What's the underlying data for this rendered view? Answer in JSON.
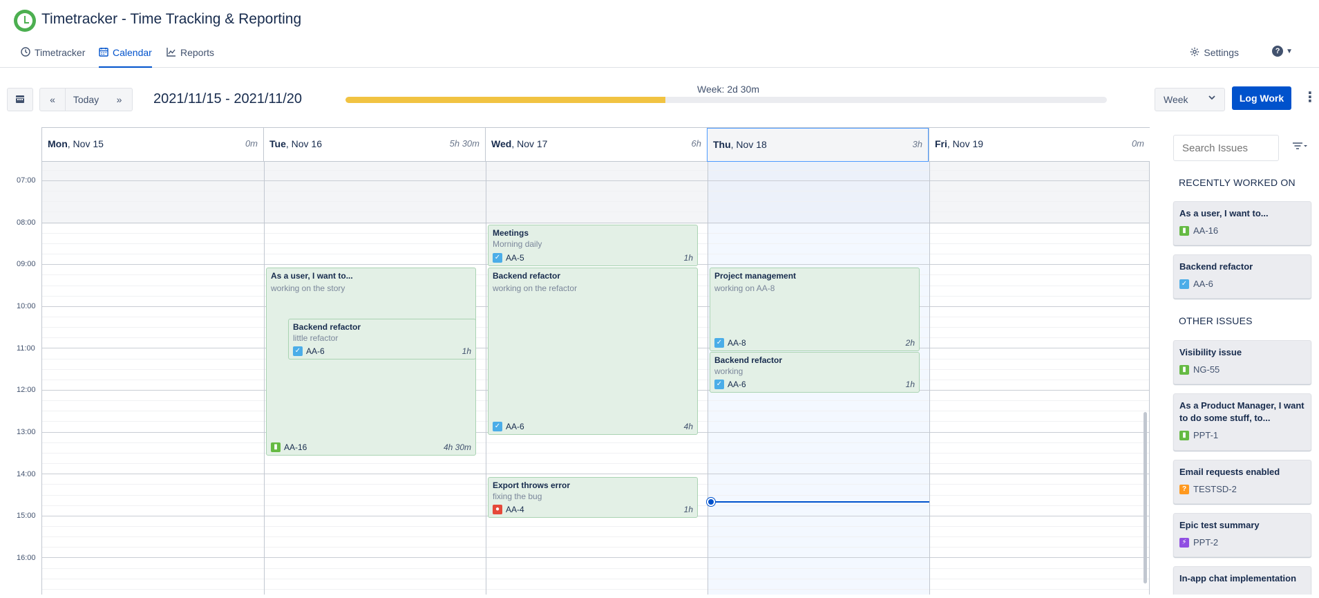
{
  "app": {
    "title": "Timetracker - Time Tracking & Reporting"
  },
  "nav": {
    "tabs": [
      {
        "label": "Timetracker",
        "icon": "clock-icon"
      },
      {
        "label": "Calendar",
        "icon": "calendar-icon",
        "active": true
      },
      {
        "label": "Reports",
        "icon": "chart-icon"
      }
    ],
    "settings_label": "Settings",
    "help_icon": "help-icon"
  },
  "toolbar": {
    "today_label": "Today",
    "prev_icon": "«",
    "next_icon": "»",
    "date_range": "2021/11/15 - 2021/11/20",
    "week_total": "Week: 2d 30m",
    "week_progress": 0.42,
    "view": "Week",
    "log_work_label": "Log Work"
  },
  "calendar": {
    "days": [
      {
        "name": "Mon",
        "date": ", Nov 15",
        "total": "0m"
      },
      {
        "name": "Tue",
        "date": ", Nov 16",
        "total": "5h 30m"
      },
      {
        "name": "Wed",
        "date": ", Nov 17",
        "total": "6h"
      },
      {
        "name": "Thu",
        "date": ", Nov 18",
        "total": "3h",
        "today": true
      },
      {
        "name": "Fri",
        "date": ", Nov 19",
        "total": "0m"
      }
    ],
    "hours": [
      "07:00",
      "08:00",
      "09:00",
      "10:00",
      "11:00",
      "12:00",
      "13:00",
      "14:00",
      "15:00",
      "16:00"
    ],
    "events": [
      {
        "title": "Meetings",
        "description": "Morning daily",
        "key": "AA-5",
        "type": "task",
        "duration": "1h"
      },
      {
        "title": "As a user, I want to...",
        "description": "working on the story",
        "key": "AA-16",
        "type": "story",
        "duration": "4h 30m"
      },
      {
        "title": "Backend refactor",
        "description": "little refactor",
        "key": "AA-6",
        "type": "task",
        "duration": "1h"
      },
      {
        "title": "Backend refactor",
        "description": "working on the refactor",
        "key": "AA-6",
        "type": "task",
        "duration": "4h"
      },
      {
        "title": "Project management",
        "description": "working on AA-8",
        "key": "AA-8",
        "type": "task",
        "duration": "2h"
      },
      {
        "title": "Backend refactor",
        "description": "working",
        "key": "AA-6",
        "type": "task",
        "duration": "1h"
      },
      {
        "title": "Export throws error",
        "description": "fixing the bug",
        "key": "AA-4",
        "type": "bug",
        "duration": "1h"
      }
    ]
  },
  "sidebar": {
    "search_placeholder": "Search Issues",
    "recent_title": "RECENTLY WORKED ON",
    "recent": [
      {
        "title": "As a user, I want to...",
        "key": "AA-16",
        "type": "story"
      },
      {
        "title": "Backend refactor",
        "key": "AA-6",
        "type": "task"
      }
    ],
    "other_title": "OTHER ISSUES",
    "other": [
      {
        "title": "Visibility issue",
        "key": "NG-55",
        "type": "story"
      },
      {
        "title": "As a Product Manager, I want to do some stuff, to...",
        "key": "PPT-1",
        "type": "story"
      },
      {
        "title": "Email requests enabled",
        "key": "TESTSD-2",
        "type": "question"
      },
      {
        "title": "Epic test summary",
        "key": "PPT-2",
        "type": "epic"
      },
      {
        "title": "In-app chat implementation",
        "key": "",
        "type": ""
      }
    ]
  },
  "colors": {
    "accent": "#0052cc",
    "progress": "#f1c342",
    "worklog_bg": "#e3f0e6",
    "worklog_border": "#a9d3b2",
    "logo": "#4caf50"
  }
}
